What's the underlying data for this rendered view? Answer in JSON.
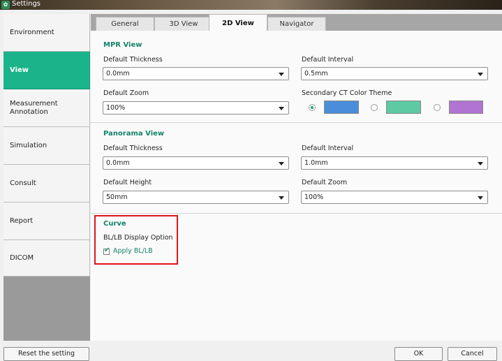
{
  "window": {
    "title": "Settings"
  },
  "sidebar": {
    "items": [
      {
        "label": "Environment"
      },
      {
        "label": "View"
      },
      {
        "label": "Measurement Annotation"
      },
      {
        "label": "Simulation"
      },
      {
        "label": "Consult"
      },
      {
        "label": "Report"
      },
      {
        "label": "DICOM"
      }
    ],
    "active_index": 1
  },
  "tabs": [
    {
      "label": "General"
    },
    {
      "label": "3D View"
    },
    {
      "label": "2D View"
    },
    {
      "label": "Navigator"
    }
  ],
  "mpr_view": {
    "title": "MPR View",
    "default_thickness": {
      "label": "Default Thickness",
      "value": "0.0mm"
    },
    "default_interval": {
      "label": "Default Interval",
      "value": "0.5mm"
    },
    "default_zoom": {
      "label": "Default Zoom",
      "value": "100%"
    },
    "color_theme": {
      "label": "Secondary CT Color Theme",
      "options": [
        {
          "color": "#4a8edb",
          "selected": true
        },
        {
          "color": "#5dcaa3",
          "selected": false
        },
        {
          "color": "#b174d2",
          "selected": false
        }
      ]
    }
  },
  "panorama_view": {
    "title": "Panorama View",
    "default_thickness": {
      "label": "Default Thickness",
      "value": "0.0mm"
    },
    "default_interval": {
      "label": "Default Interval",
      "value": "1.0mm"
    },
    "default_height": {
      "label": "Default Height",
      "value": "50mm"
    },
    "default_zoom": {
      "label": "Default Zoom",
      "value": "100%"
    }
  },
  "curve": {
    "title": "Curve",
    "option_label": "BL/LB Display Option",
    "apply_label": "Apply BL/LB",
    "apply_checked": true
  },
  "footer": {
    "reset_label": "Reset the setting",
    "ok_label": "OK",
    "cancel_label": "Cancel"
  },
  "colors": {
    "accent": "#1bb48a",
    "section_title": "#14826a",
    "highlight": "#e0141c"
  }
}
